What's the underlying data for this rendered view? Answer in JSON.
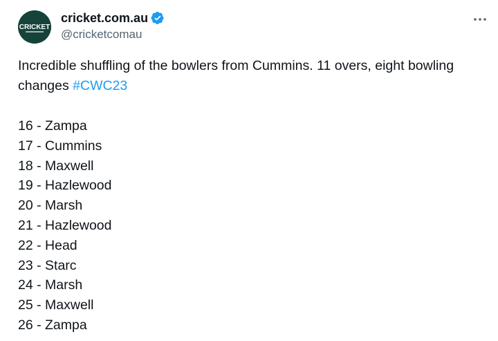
{
  "account": {
    "display_name": "cricket.com.au",
    "handle": "@cricketcomau",
    "avatar_text": "CRICKET"
  },
  "tweet": {
    "text_line1": "Incredible shuffling of the bowlers from Cummins. 11 overs, eight bowling",
    "text_line2": "changes",
    "hashtag": "#CWC23",
    "overs": [
      "16 - Zampa",
      "17 - Cummins",
      "18 - Maxwell",
      "19 - Hazlewood",
      "20 - Marsh",
      "21 - Hazlewood",
      "22 - Head",
      "23 - Starc",
      "24 - Marsh",
      "25 - Maxwell",
      "26 - Zampa"
    ]
  },
  "colors": {
    "avatar_bg": "#15433a",
    "verified": "#1d9bf0",
    "hashtag": "#1d9bf0"
  },
  "icons": {
    "verified": "verified-badge-icon",
    "more": "more-options-icon"
  }
}
